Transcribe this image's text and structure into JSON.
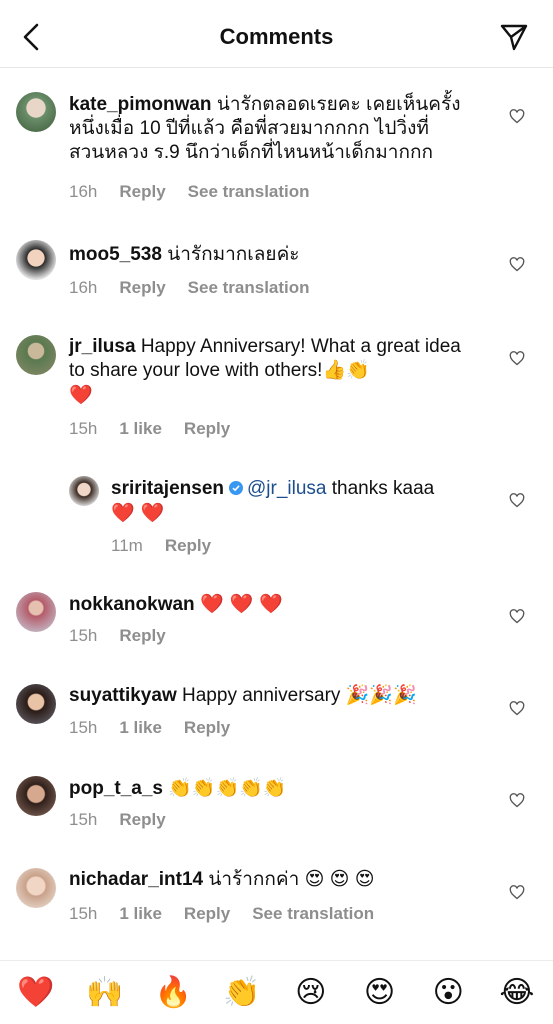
{
  "header": {
    "title": "Comments"
  },
  "comments": [
    {
      "username": "kate_pimonwan",
      "text": "น่ารักตลอดเรยคะ เคยเห็นครั้งหนึ่งเมื่อ 10 ปีที่แล้ว คือพี่สวยมากกกก ไปวิ่งที่สวนหลวง ร.9 นึกว่าเด็กที่ไหนหน้าเด็กมากกก",
      "time": "16h",
      "reply": "Reply",
      "translate": "See translation"
    },
    {
      "username": "moo5_538",
      "text": "น่ารักมากเลยค่ะ",
      "time": "16h",
      "reply": "Reply",
      "translate": "See translation"
    },
    {
      "username": "jr_ilusa",
      "text": "Happy Anniversary! What a great idea to share your love with others!👍👏",
      "text2": "❤️",
      "time": "15h",
      "likes": "1 like",
      "reply": "Reply"
    },
    {
      "username": "sriritajensen",
      "mention": "@jr_ilusa",
      "text": "thanks kaaa",
      "text2": "❤️ ❤️",
      "time": "11m",
      "reply": "Reply"
    },
    {
      "username": "nokkanokwan",
      "text": "❤️ ❤️ ❤️",
      "time": "15h",
      "reply": "Reply"
    },
    {
      "username": "suyattikyaw",
      "text": "Happy anniversary 🎉🎉🎉",
      "time": "15h",
      "likes": "1 like",
      "reply": "Reply"
    },
    {
      "username": "pop_t_a_s",
      "text": "👏👏👏👏👏",
      "time": "15h",
      "reply": "Reply"
    },
    {
      "username": "nichadar_int14",
      "text": "น่าร้ากกค่า 😍 😍 😍",
      "time": "15h",
      "likes": "1 like",
      "reply": "Reply",
      "translate": "See translation"
    }
  ],
  "emoji_bar": [
    "❤️",
    "🙌",
    "🔥",
    "👏",
    "😢",
    "😍",
    "😮",
    "😂"
  ],
  "colors": {
    "mention": "#1c4e8f",
    "verified": "#3897f0",
    "meta": "#8e8e8e"
  }
}
